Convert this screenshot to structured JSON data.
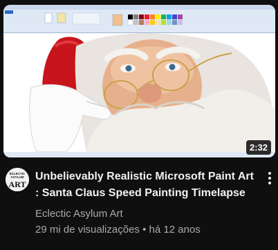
{
  "video": {
    "duration": "2:32",
    "title": "Unbelievably Realistic Microsoft Paint Art : Santa Claus Speed Painting Timelapse",
    "channel": "Eclectic Asylum Art",
    "views": "29 mi de visualizações",
    "separator": "•",
    "age": "há 12 anos"
  },
  "avatar": {
    "logo_text": "ART",
    "brand_lines": [
      "ECLECTIC",
      "ASYLUM"
    ]
  },
  "colors": {
    "background": "#0f0f0f",
    "title": "#f1f1f1",
    "secondary_text": "#aaaaaa"
  }
}
